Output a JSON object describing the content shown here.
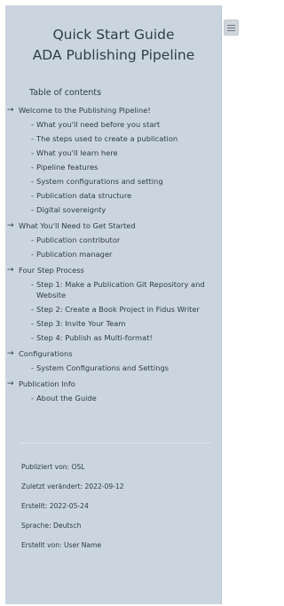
{
  "header": {
    "title_line1": "Quick Start Guide",
    "title_line2": "ADA Publishing Pipeline"
  },
  "toc": {
    "heading": "Table of contents",
    "arrow": "→",
    "sections": [
      {
        "label": "Welcome to the Publishing Pipeline!",
        "items": [
          "What you'll need before you start",
          "The steps used to create a publication",
          "What you'll learn here",
          "Pipeline features",
          "System configurations and setting",
          "Publication data structure",
          "Digital sovereignty"
        ]
      },
      {
        "label": "What You'll Need to Get Started",
        "items": [
          "Publication contributor",
          "Publication manager"
        ]
      },
      {
        "label": "Four Step Process",
        "items": [
          "Step 1: Make a Publication Git Repository and Website",
          "Step 2: Create a Book Project in Fidus Writer",
          "Step 3: Invite Your Team",
          "Step 4: Publish as Multi-format!"
        ]
      },
      {
        "label": "Configurations",
        "items": [
          "System Configurations and Settings"
        ]
      },
      {
        "label": "Publication Info",
        "items": [
          "About the Guide"
        ]
      }
    ]
  },
  "meta": {
    "published_by": "Publiziert von: OSL",
    "last_modified": "Zuletzt verändert: 2022-09-12",
    "created": "Erstellt: 2022-05-24",
    "language": "Sprache: Deutsch",
    "created_by": "Erstellt von: User Name"
  },
  "colors": {
    "sidebar_bg": "#cad5df",
    "text": "#2f3b45"
  },
  "icons": {
    "toggle": "hamburger-menu-icon",
    "section_bullet": "arrow-right-icon"
  }
}
